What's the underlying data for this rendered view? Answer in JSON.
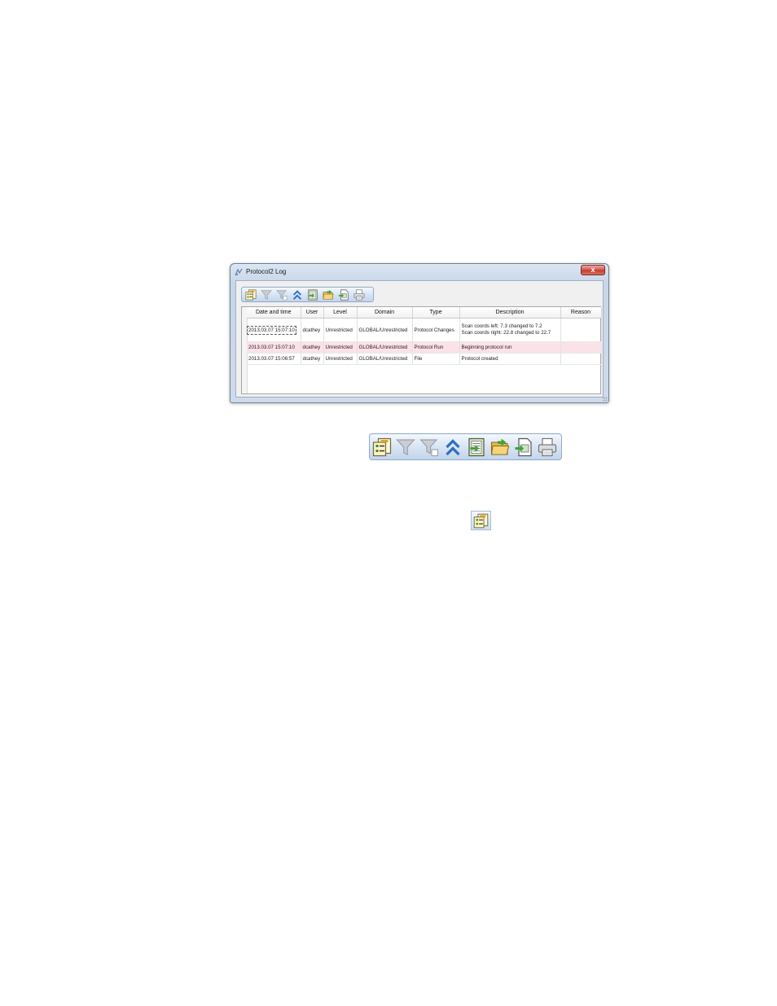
{
  "window": {
    "title": "Protocol2 Log",
    "close_glyph": "x",
    "app_icon": "protocol-log-icon"
  },
  "toolbar": {
    "buttons": [
      {
        "icon": "choose-columns-icon"
      },
      {
        "icon": "filter-icon"
      },
      {
        "icon": "clear-filter-icon"
      },
      {
        "icon": "collapse-all-icon"
      },
      {
        "icon": "export-icon"
      },
      {
        "icon": "open-folder-icon"
      },
      {
        "icon": "import-icon"
      },
      {
        "icon": "print-icon"
      }
    ]
  },
  "table": {
    "columns": [
      "Date and time",
      "User",
      "Level",
      "Domain",
      "Type",
      "Description",
      "Reason"
    ],
    "rows": [
      {
        "date": "2013.03.07 15:07:10",
        "user": "dcathey",
        "level": "Unrestricted",
        "domain": "GLOBAL/Unrestricted",
        "type": "Protocol Changes",
        "description_line1": "Scan coords left: 7.3 changed to 7.2",
        "description_line2": "Scan coords right: 22.8 changed to 22.7",
        "reason": ""
      },
      {
        "date": "2013.03.07 15:07:10",
        "user": "dcathey",
        "level": "Unrestricted",
        "domain": "GLOBAL/Unrestricted",
        "type": "Protocol Run",
        "description": "Beginning protocol run",
        "reason": ""
      },
      {
        "date": "2013.03.07 15:06:57",
        "user": "dcathey",
        "level": "Unrestricted",
        "domain": "GLOBAL/Unrestricted",
        "type": "File",
        "description": "Protocol created",
        "reason": ""
      }
    ],
    "selected_row_color": "#fbe1e8"
  },
  "colors": {
    "accent_blue": "#2f6fc4",
    "toolbar_border": "#8fa9cc",
    "close_red": "#c23a2c"
  }
}
